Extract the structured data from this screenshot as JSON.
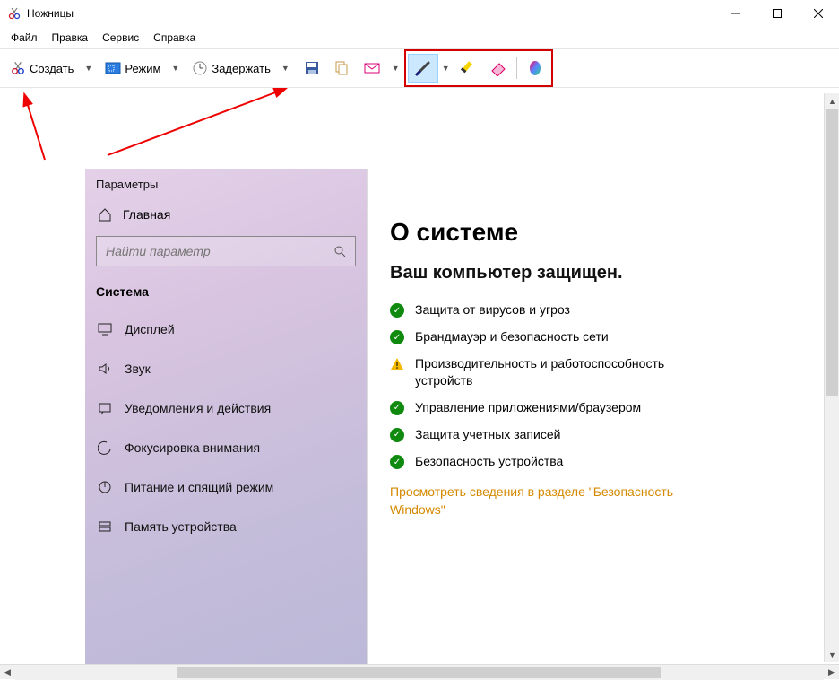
{
  "window": {
    "title": "Ножницы"
  },
  "menu": [
    "Файл",
    "Правка",
    "Сервис",
    "Справка"
  ],
  "toolbar": {
    "create": "Создать",
    "mode": "Режим",
    "delay": "Задержать"
  },
  "settings": {
    "title": "Параметры",
    "home": "Главная",
    "search_placeholder": "Найти параметр",
    "section": "Система",
    "items": [
      "Дисплей",
      "Звук",
      "Уведомления и действия",
      "Фокусировка внимания",
      "Питание и спящий режим",
      "Память устройства"
    ]
  },
  "about": {
    "heading": "О системе",
    "subheading": "Ваш компьютер защищен.",
    "status": [
      {
        "state": "ok",
        "text": "Защита от вирусов и угроз"
      },
      {
        "state": "ok",
        "text": "Брандмауэр и безопасность сети"
      },
      {
        "state": "warn",
        "text": "Производительность и работоспособность устройств"
      },
      {
        "state": "ok",
        "text": "Управление приложениями/браузером"
      },
      {
        "state": "ok",
        "text": "Защита учетных записей"
      },
      {
        "state": "ok",
        "text": "Безопасность устройства"
      }
    ],
    "link": "Просмотреть сведения в разделе \"Безопасность Windows\""
  }
}
